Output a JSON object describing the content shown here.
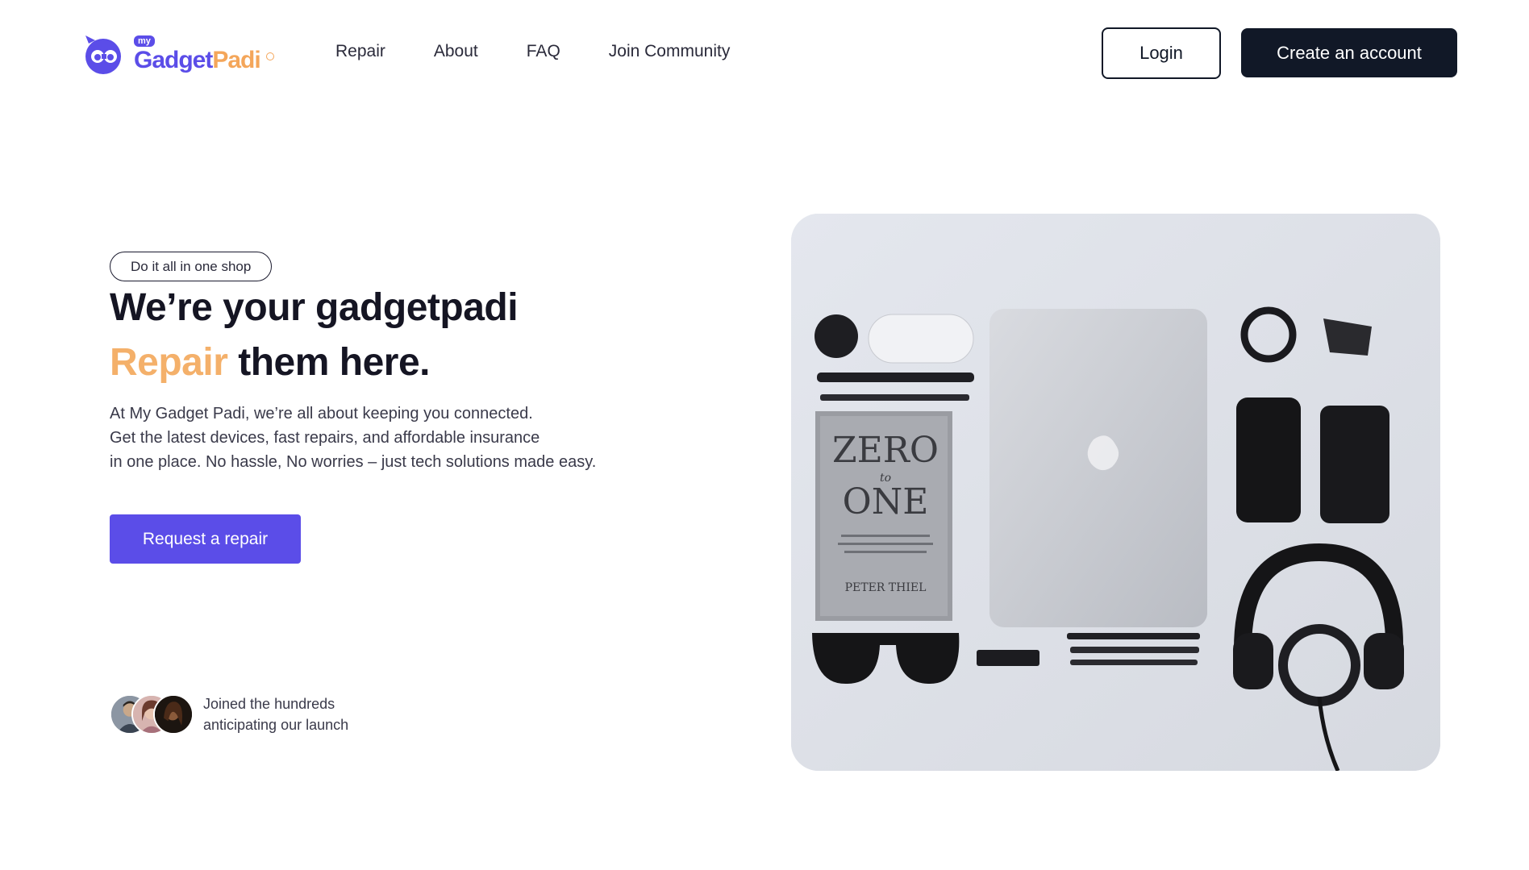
{
  "brand": {
    "my_badge": "my",
    "name_part1": "Gadget",
    "name_part2": "Padi",
    "primary_color": "#5b4de8",
    "accent_color": "#f4a65a"
  },
  "nav": {
    "items": [
      {
        "label": "Repair"
      },
      {
        "label": "About"
      },
      {
        "label": "FAQ"
      },
      {
        "label": "Join Community"
      }
    ]
  },
  "header_actions": {
    "login_label": "Login",
    "create_account_label": "Create an account"
  },
  "hero": {
    "pill": "Do it all in one shop",
    "heading_line1": "We’re your gadgetpadi",
    "heading_accent": "Repair",
    "heading_rest": "them here.",
    "description_lines": [
      "At My Gadget Padi, we’re all about keeping you connected.",
      "Get the latest devices, fast repairs, and affordable insurance",
      "in one place. No hassle, No worries – just tech solutions made easy."
    ],
    "cta_label": "Request a repair",
    "social_proof_lines": [
      "Joined the hundreds",
      "anticipating our launch"
    ],
    "image_book_title_1": "ZERO",
    "image_book_title_2": "to",
    "image_book_title_3": "ONE",
    "image_book_author": "PETER THIEL"
  }
}
